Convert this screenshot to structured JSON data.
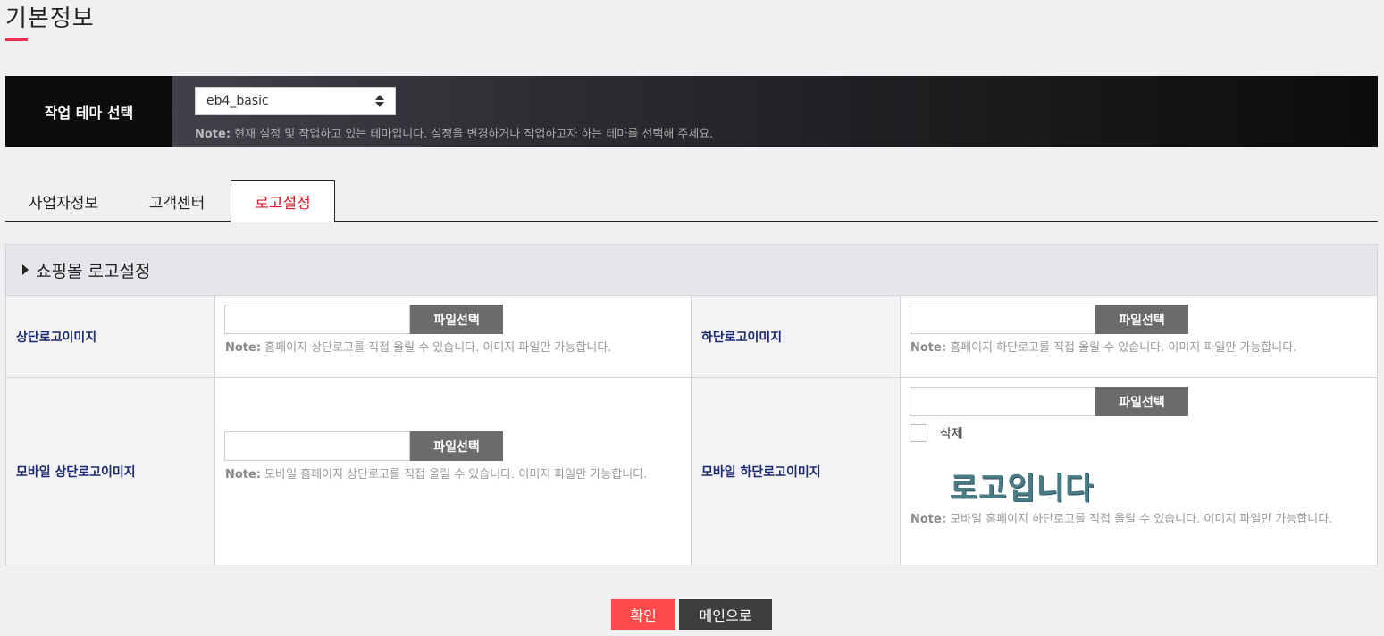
{
  "page": {
    "title": "기본정보"
  },
  "theme": {
    "label": "작업 테마 선택",
    "selected": "eb4_basic",
    "note_prefix": "Note:",
    "note_text": " 현재 설정 및 작업하고 있는 테마입니다. 설정을 변경하거나 작업하고자 하는 테마를 선택해 주세요."
  },
  "tabs": [
    {
      "label": "사업자정보",
      "active": false
    },
    {
      "label": "고객센터",
      "active": false
    },
    {
      "label": "로고설정",
      "active": true
    }
  ],
  "panel": {
    "title": "쇼핑몰 로고설정",
    "file_button_label": "파일선택",
    "rows": {
      "top_logo": {
        "label": "상단로고이미지",
        "note_prefix": "Note:",
        "note_text": " 홈페이지 상단로고를 직접 올릴 수 있습니다. 이미지 파일만 가능합니다."
      },
      "bottom_logo": {
        "label": "하단로고이미지",
        "note_prefix": "Note:",
        "note_text": " 홈페이지 하단로고를 직접 올릴 수 있습니다. 이미지 파일만 가능합니다."
      },
      "mobile_top_logo": {
        "label": "모바일 상단로고이미지",
        "note_prefix": "Note:",
        "note_text": " 모바일 홈페이지 상단로고를 직접 올릴 수 있습니다. 이미지 파일만 가능합니다."
      },
      "mobile_bottom_logo": {
        "label": "모바일 하단로고이미지",
        "delete_label": "삭제",
        "logo_preview_text": "로고입니다",
        "note_prefix": "Note:",
        "note_text": " 모바일 홈페이지 하단로고를 직접 올릴 수 있습니다. 이미지 파일만 가능합니다."
      }
    }
  },
  "actions": {
    "confirm_label": "확인",
    "main_label": "메인으로"
  },
  "colors": {
    "accent": "#e8304a",
    "label_text": "#1b2a6e",
    "confirm_bg": "#ff4b4b",
    "tab_active": "#d6182a"
  }
}
